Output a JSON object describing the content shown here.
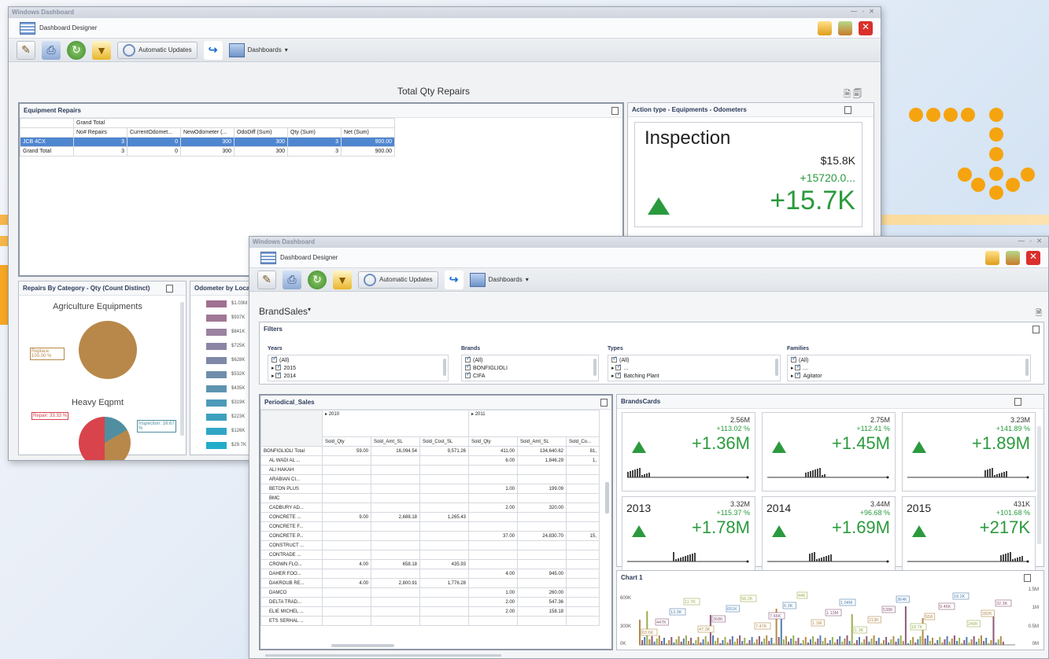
{
  "colors": {
    "accent_orange": "#f5a410",
    "kpi_green": "#2b9a3e",
    "selection_blue": "#4f86d0"
  },
  "back_window": {
    "title": "Windows Dashboard",
    "designer_label": "Dashboard Designer",
    "toolbar": {
      "auto_updates": "Automatic Updates",
      "dashboards": "Dashboards"
    },
    "dashboard_title": "Total Qty Repairs",
    "equipment_repairs": {
      "title": "Equipment Repairs",
      "group_header": "Grand Total",
      "columns": [
        "No# Repairs",
        "CurrentOdomet...",
        "NewOdometer (...",
        "OdoDiff (Sum)",
        "Qty (Sum)",
        "Net (Sum)"
      ],
      "rows": [
        {
          "label": "JCB 4CX",
          "values": [
            "3",
            "0",
            "300",
            "300",
            "3",
            "900.00"
          ]
        },
        {
          "label": "Grand Total",
          "values": [
            "3",
            "0",
            "300",
            "300",
            "3",
            "900.00"
          ]
        }
      ]
    },
    "action_type": {
      "title": "Action type - Equipments - Odometers",
      "card": {
        "name": "Inspection",
        "top": "$15.8K",
        "sub": "+15720.0...",
        "main": "+15.7K"
      }
    },
    "repairs_by_category": {
      "title": "Repairs By Category - Qty (Count Distinct)",
      "pie1_title": "Agriculture Equipments",
      "pie1_label": "Replace: 100.00 %",
      "pie2_title": "Heavy Eqpmt",
      "pie2_label1": "Repair: 33.33 %",
      "pie2_label2": "Inspection: 16.67 %"
    },
    "odometer": {
      "title": "Odometer by Loca",
      "labels": [
        "$1.03M",
        "$937K",
        "$841K",
        "$725K",
        "$628K",
        "$532K",
        "$435K",
        "$319K",
        "$223K",
        "$126K",
        "$29.7K"
      ]
    }
  },
  "front_window": {
    "title": "Windows Dashboard",
    "designer_label": "Dashboard Designer",
    "toolbar": {
      "auto_updates": "Automatic Updates",
      "dashboards": "Dashboards"
    },
    "dashboard_title": "BrandSales",
    "filters": {
      "title": "Filters",
      "years": {
        "label": "Years",
        "items": [
          "(All)",
          "2015",
          "2014"
        ]
      },
      "brands": {
        "label": "Brands",
        "items": [
          "(All)",
          "BONFIGLIOLI",
          "CIFA"
        ]
      },
      "types": {
        "label": "Types",
        "items": [
          "(All)",
          "...",
          "Batching Plant"
        ]
      },
      "families": {
        "label": "Families",
        "items": [
          "(All)",
          "...",
          "Agitator"
        ]
      }
    },
    "periodical_sales": {
      "title": "Periodical_Sales",
      "year1": "2010",
      "year2": "2011",
      "columns": [
        "Sold_Qty",
        "Sold_Amt_SL",
        "Sold_Cost_SL",
        "Sold_Qty",
        "Sold_Amt_SL",
        "Sold_Co..."
      ],
      "rows": [
        {
          "label": "BONFIGLIOLI Total",
          "values": [
            "59.00",
            "16,094.54",
            "9,571.26",
            "411.00",
            "134,640.62",
            "81,"
          ]
        },
        {
          "label": "AL WADI AL ...",
          "values": [
            "",
            "",
            "",
            "6.00",
            "1,846.29",
            "1,"
          ]
        },
        {
          "label": "ALI HAKAH",
          "values": [
            "",
            "",
            "",
            "",
            "",
            ""
          ]
        },
        {
          "label": "ARABIAN CI...",
          "values": [
            "",
            "",
            "",
            "",
            "",
            ""
          ]
        },
        {
          "label": "BETON PLUS",
          "values": [
            "",
            "",
            "",
            "1.00",
            "199.09",
            ""
          ]
        },
        {
          "label": "BMC",
          "values": [
            "",
            "",
            "",
            "",
            "",
            ""
          ]
        },
        {
          "label": "CADBURY AD...",
          "values": [
            "",
            "",
            "",
            "2.00",
            "320.00",
            ""
          ]
        },
        {
          "label": "CONCRETE ...",
          "values": [
            "9.00",
            "2,688.18",
            "1,265.43",
            "",
            "",
            ""
          ]
        },
        {
          "label": "CONCRETE F...",
          "values": [
            "",
            "",
            "",
            "",
            "",
            ""
          ]
        },
        {
          "label": "CONCRETE P...",
          "values": [
            "",
            "",
            "",
            "37.00",
            "24,830.70",
            "15,"
          ]
        },
        {
          "label": "CONSTRUCT ...",
          "values": [
            "",
            "",
            "",
            "",
            "",
            ""
          ]
        },
        {
          "label": "CONTRADE ...",
          "values": [
            "",
            "",
            "",
            "",
            "",
            ""
          ]
        },
        {
          "label": "CROWN FLO...",
          "values": [
            "4.00",
            "658.18",
            "435.93",
            "",
            "",
            ""
          ]
        },
        {
          "label": "DAHER FOO...",
          "values": [
            "",
            "",
            "",
            "4.00",
            "945.00",
            ""
          ]
        },
        {
          "label": "DAKROUB RE...",
          "values": [
            "4.00",
            "2,800.91",
            "1,776.28",
            "",
            "",
            ""
          ]
        },
        {
          "label": "DAMCO",
          "values": [
            "",
            "",
            "",
            "1.00",
            "260.00",
            ""
          ]
        },
        {
          "label": "DELTA TRAD...",
          "values": [
            "",
            "",
            "",
            "2.00",
            "547.36",
            ""
          ]
        },
        {
          "label": "ELIE MICHEL ...",
          "values": [
            "",
            "",
            "",
            "2.00",
            "158.18",
            ""
          ]
        },
        {
          "label": "ETS SERHAL ...",
          "values": [
            "",
            "",
            "",
            "",
            "",
            ""
          ]
        }
      ]
    },
    "brands_cards": {
      "title": "BrandsCards",
      "cards": [
        {
          "year": "",
          "top": "2.56M",
          "pct": "+113.02 %",
          "main": "+1.36M"
        },
        {
          "year": "",
          "top": "2.75M",
          "pct": "+112.41 %",
          "main": "+1.45M"
        },
        {
          "year": "",
          "top": "3.23M",
          "pct": "+141.89 %",
          "main": "+1.89M"
        },
        {
          "year": "2013",
          "top": "3.32M",
          "pct": "+115.37 %",
          "main": "+1.78M"
        },
        {
          "year": "2014",
          "top": "3.44M",
          "pct": "+96.68 %",
          "main": "+1.69M"
        },
        {
          "year": "2015",
          "top": "431K",
          "pct": "+101.68 %",
          "main": "+217K"
        }
      ]
    },
    "chart1": {
      "title": "Chart 1",
      "left_ticks": [
        "600K",
        "300K",
        "0K"
      ],
      "right_ticks": [
        "1.5M",
        "1M",
        "0.5M",
        "0M"
      ]
    }
  },
  "chart_data": {
    "type": "bar",
    "title": "Chart 1",
    "ylim_left": [
      0,
      600000
    ],
    "ylim_right": [
      0,
      1500000
    ],
    "data_labels": [
      "63.6K",
      "447K",
      "13.3K",
      "11.7K",
      "47.3K",
      "368K",
      "651K",
      "58.2K",
      "7.47K",
      "7.66K",
      "6.3K",
      "44K",
      "1.1M",
      "1.13M",
      "1.04M",
      "1.3K",
      "213K",
      "538K",
      "364K",
      "18.7K",
      "558",
      "9.46K",
      "18.2K",
      "240K",
      "282K",
      "32.3K"
    ],
    "grid": false,
    "legend": "none"
  }
}
